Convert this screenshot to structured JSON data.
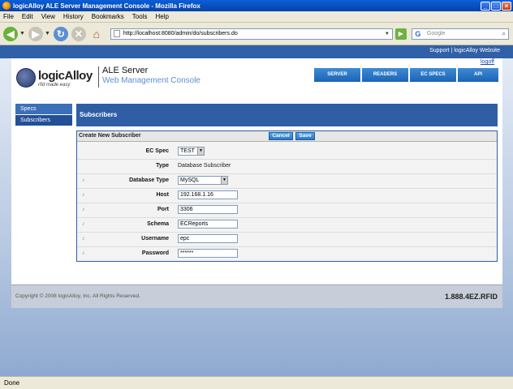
{
  "window": {
    "title": "logicAlloy ALE Server Management Console - Mozilla Firefox",
    "buttons": {
      "minimize": "_",
      "maximize": "□",
      "close": "×"
    }
  },
  "menu": [
    "File",
    "Edit",
    "View",
    "History",
    "Bookmarks",
    "Tools",
    "Help"
  ],
  "toolbar": {
    "url": "http://localhost:8080/admin/do/subscribers.do",
    "search_placeholder": "Google"
  },
  "header": {
    "top_links": "Support | logicAlloy Website",
    "logoff": "logoff",
    "logo_name": "logicAlloy",
    "logo_tag": "rfid made easy",
    "app_title_1": "ALE Server",
    "app_title_2": "Web Management Console",
    "nav": [
      "SERVER",
      "READERS",
      "EC SPECS",
      "API"
    ]
  },
  "sidebar": {
    "items": [
      "Specs",
      "Subscribers"
    ]
  },
  "section": {
    "title": "Subscribers"
  },
  "form": {
    "title": "Create New Subscriber",
    "cancel_label": "Cancel",
    "save_label": "Save",
    "fields": {
      "ec_spec": {
        "label": "EC Spec",
        "value": "TEST"
      },
      "type": {
        "label": "Type",
        "value": "Database Subscriber"
      },
      "database_type": {
        "label": "Database Type",
        "value": "MySQL"
      },
      "host": {
        "label": "Host",
        "value": "192.168.1.16"
      },
      "port": {
        "label": "Port",
        "value": "3306"
      },
      "schema": {
        "label": "Schema",
        "value": "ECReports"
      },
      "username": {
        "label": "Username",
        "value": "epc"
      },
      "password": {
        "label": "Password",
        "value": "******"
      }
    }
  },
  "footer": {
    "copyright": "Copyright © 2008 logicAlloy, Inc.  All Rights Reserved.",
    "phone": "1.888.4EZ.RFID"
  },
  "status": {
    "text": "Done"
  }
}
